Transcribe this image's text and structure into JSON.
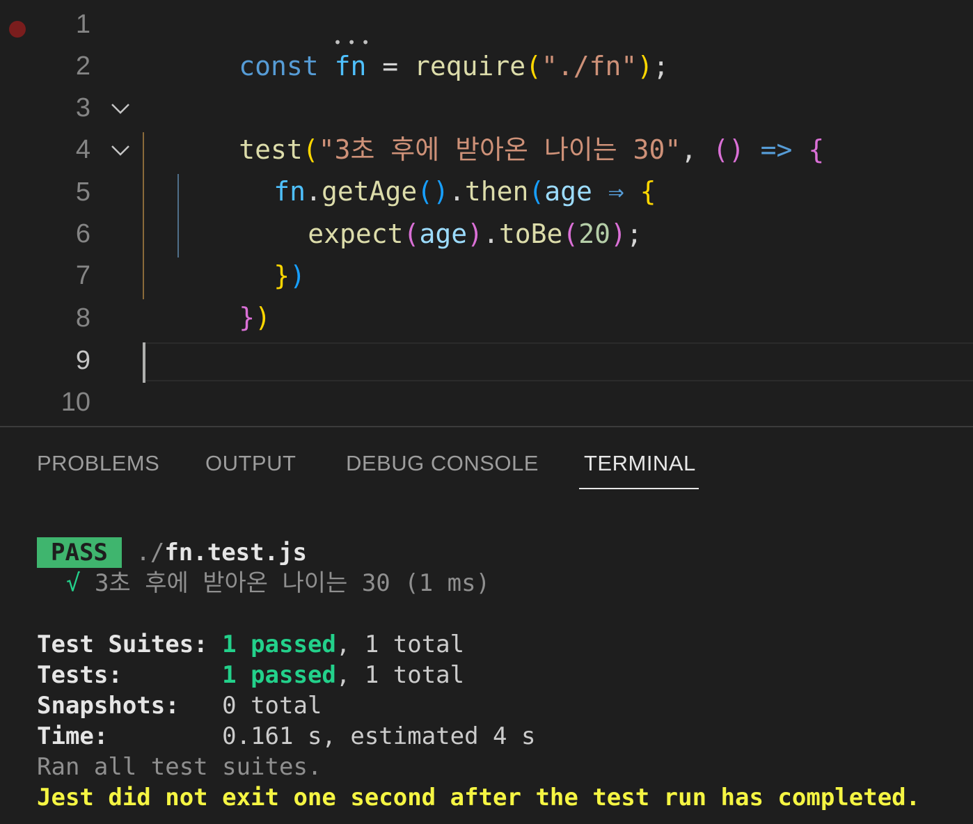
{
  "editor": {
    "line_numbers": [
      "1",
      "2",
      "3",
      "4",
      "5",
      "6",
      "7",
      "8",
      "9",
      "10"
    ],
    "line1": {
      "t1": "const",
      "t2": "fn",
      "t3": "=",
      "t4": "require",
      "t5": "(",
      "t6": "\"./fn\"",
      "t7": ")",
      "t8": ";"
    },
    "line3": {
      "t1": "test",
      "t2": "(",
      "t3": "\"3초 후에 받아온 나이는 30\"",
      "t4": ",",
      "t5": "()",
      "t6": "=>",
      "t7": "{"
    },
    "line4": {
      "t1": "fn",
      "t2": ".",
      "t3": "getAge",
      "t4": "()",
      "t5": ".",
      "t6": "then",
      "t7": "(",
      "t8": "age",
      "t9": "⇒",
      "t10": "{"
    },
    "line5": {
      "t1": "expect",
      "t2": "(",
      "t3": "age",
      "t4": ")",
      "t5": ".",
      "t6": "toBe",
      "t7": "(",
      "t8": "20",
      "t9": ")",
      "t10": ";"
    },
    "line6": {
      "t1": "}",
      "t2": ")"
    },
    "line7": {
      "t1": "}",
      "t2": ")"
    }
  },
  "panel": {
    "tabs": [
      "PROBLEMS",
      "OUTPUT",
      "DEBUG CONSOLE",
      "TERMINAL"
    ],
    "active_tab": "TERMINAL"
  },
  "terminal": {
    "pass_badge": "PASS",
    "file_prefix": "./",
    "file_name": "fn.test.js",
    "check": "√",
    "test_name": "3초 후에 받아온 나이는 30 (1 ms)",
    "suites_label": "Test Suites:",
    "suites_passed": "1 passed",
    "suites_total": ", 1 total",
    "tests_label": "Tests:",
    "tests_passed": "1 passed",
    "tests_total": ", 1 total",
    "snapshots_label": "Snapshots:",
    "snapshots_value": "0 total",
    "time_label": "Time:",
    "time_value": "0.161 s, estimated 4 s",
    "ran_all": "Ran all test suites.",
    "jest_warning": "Jest did not exit one second after the test run has completed."
  },
  "colors": {
    "background": "#1e1e1e",
    "pass_badge": "#3fb56e",
    "passed_text": "#23d18b",
    "warning_text": "#f5f543"
  }
}
